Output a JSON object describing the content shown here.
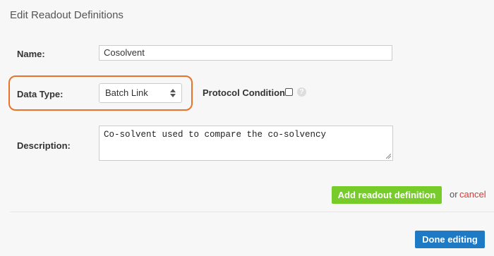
{
  "page": {
    "title": "Edit Readout Definitions"
  },
  "form": {
    "name_label": "Name:",
    "name_value": "Cosolvent",
    "data_type_label": "Data Type:",
    "data_type_value": "Batch Link",
    "protocol_condition_label": "Protocol Condition:",
    "protocol_condition_checked": false,
    "help_icon_glyph": "?",
    "description_label": "Description:",
    "description_value": "Co-solvent used to compare the co-solvency"
  },
  "actions": {
    "add_label": "Add readout definition",
    "or_text": "or",
    "cancel_label": "cancel",
    "done_label": "Done editing"
  },
  "colors": {
    "accent_highlight": "#e8742c",
    "add_button": "#78cc2a",
    "done_button": "#1f7ac6",
    "cancel_link": "#d03b36"
  }
}
